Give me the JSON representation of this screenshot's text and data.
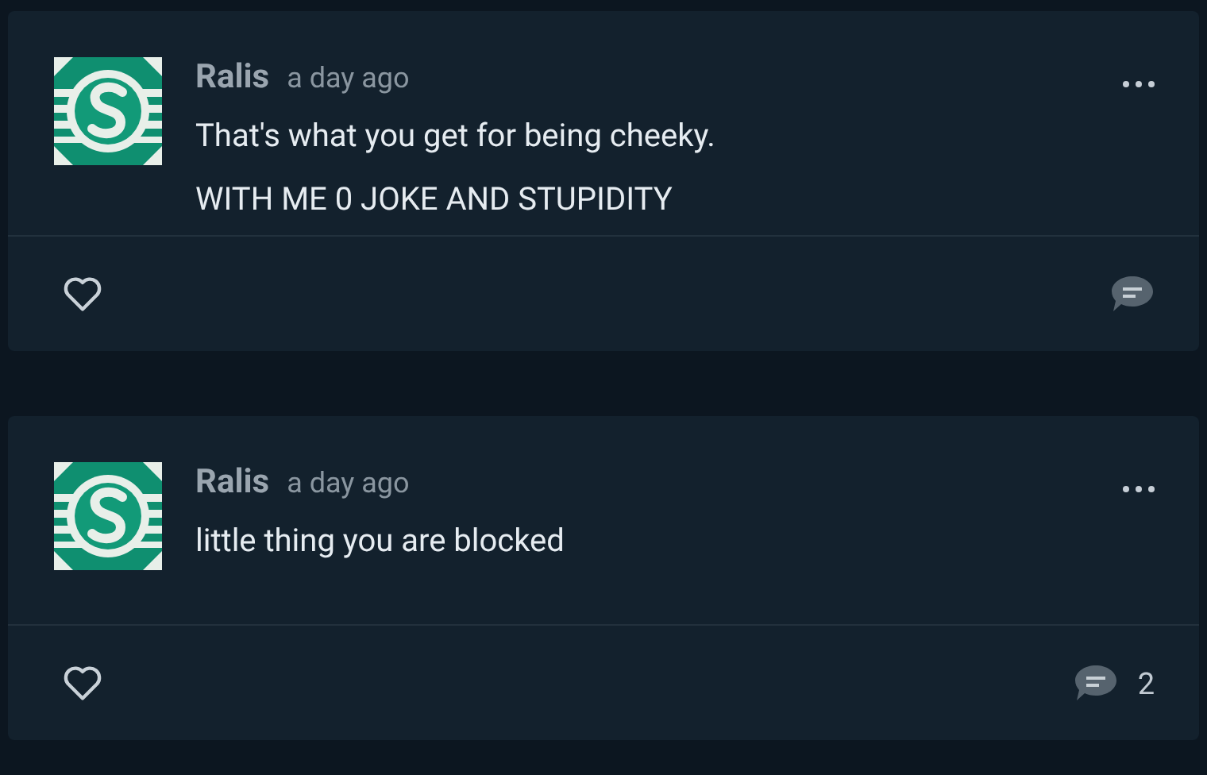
{
  "posts": [
    {
      "author": "Ralis",
      "time": "a day ago",
      "lines": [
        "That's what you get for being cheeky.",
        "WITH ME 0 JOKE AND STUPIDITY"
      ]
    },
    {
      "author": "Ralis",
      "time": "a day ago",
      "lines": [
        "little thing you are blocked"
      ],
      "reply_count": "2"
    }
  ]
}
